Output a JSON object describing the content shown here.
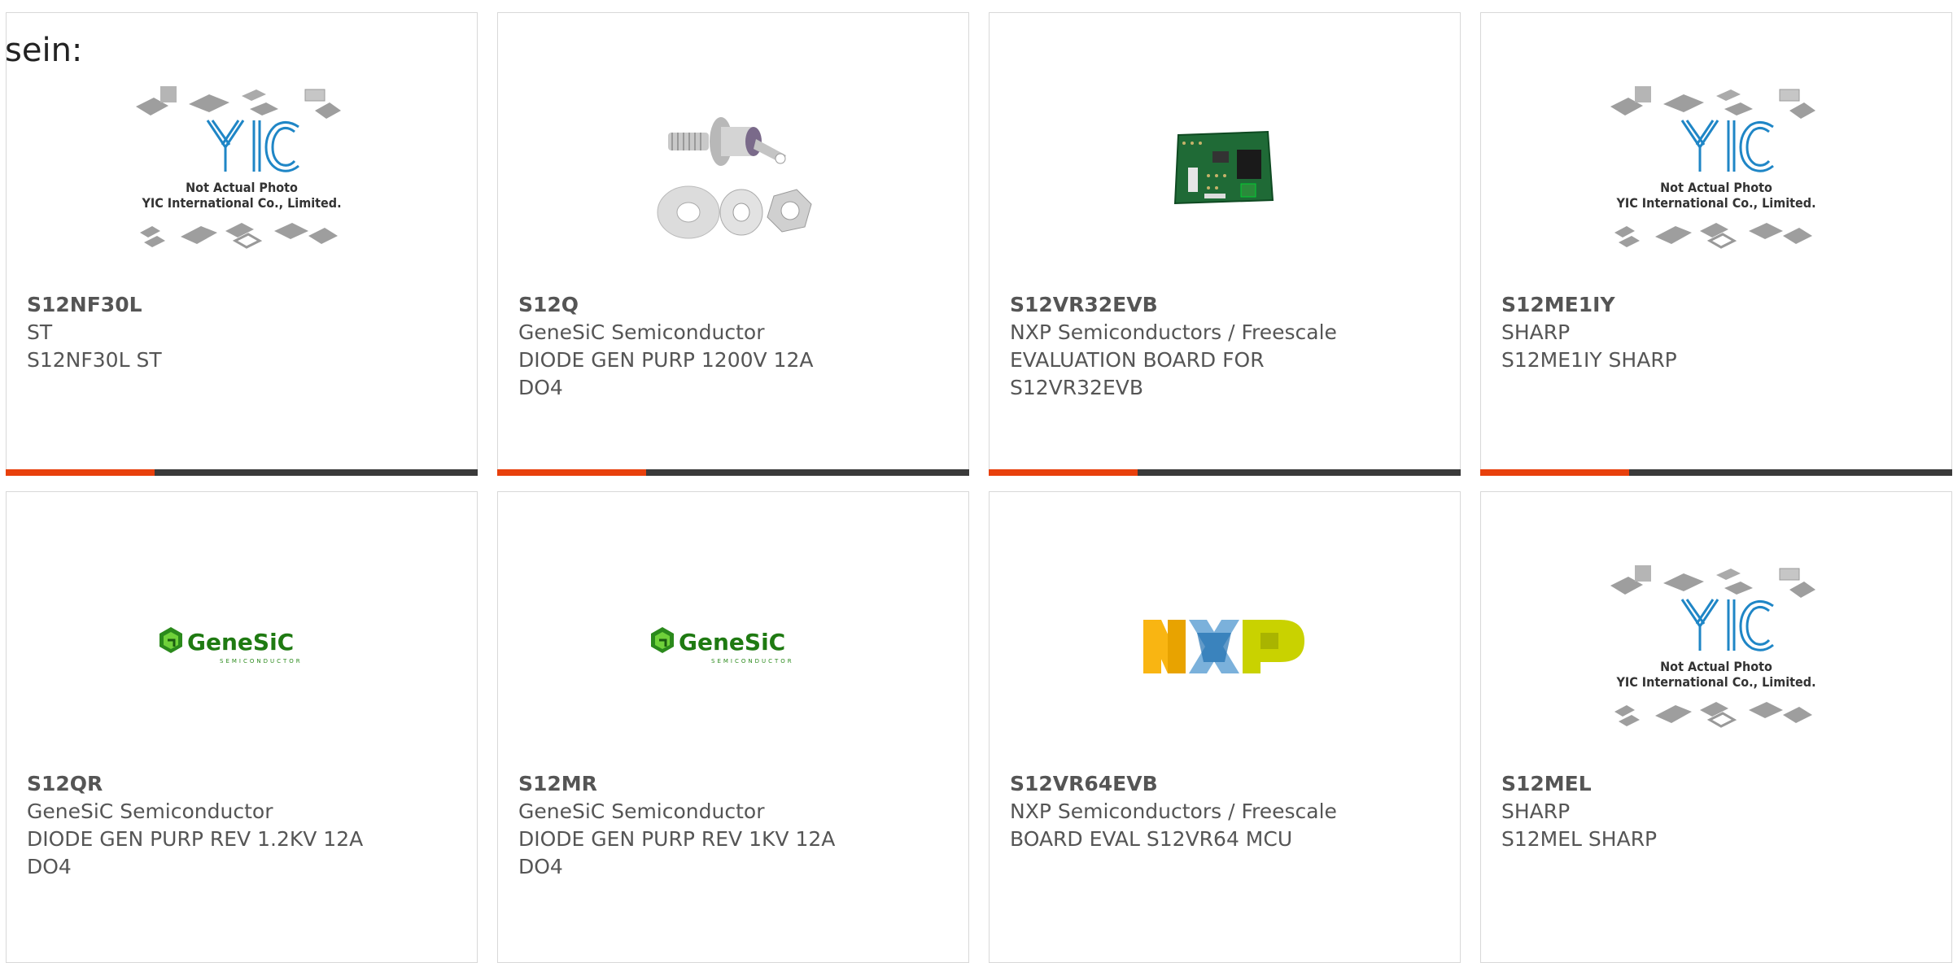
{
  "page": {
    "heading": "sein:"
  },
  "placeholder_image": {
    "line1": "Not Actual Photo",
    "line2": "YIC International Co., Limited."
  },
  "logos": {
    "genesic_word": "GeneSiC",
    "genesic_sub": "SEMICONDUCTOR"
  },
  "colors": {
    "accent": "#e8400c",
    "bar_dark": "#3a3a3a",
    "text": "#555555",
    "border": "#d8d8d8"
  },
  "products": [
    {
      "part": "S12NF30L",
      "manufacturer": "ST",
      "desc1": "S12NF30L ST",
      "desc2": "",
      "image": "yic-placeholder"
    },
    {
      "part": "S12Q",
      "manufacturer": "GeneSiC Semiconductor",
      "desc1": "DIODE GEN PURP 1200V 12A",
      "desc2": "DO4",
      "image": "stud-diode-photo"
    },
    {
      "part": "S12VR32EVB",
      "manufacturer": "NXP Semiconductors / Freescale",
      "desc1": "EVALUATION BOARD FOR",
      "desc2": "S12VR32EVB",
      "image": "pcb-board-photo"
    },
    {
      "part": "S12ME1IY",
      "manufacturer": "SHARP",
      "desc1": "S12ME1IY SHARP",
      "desc2": "",
      "image": "yic-placeholder"
    },
    {
      "part": "S12QR",
      "manufacturer": "GeneSiC Semiconductor",
      "desc1": "DIODE GEN PURP REV 1.2KV 12A",
      "desc2": "DO4",
      "image": "genesic-logo"
    },
    {
      "part": "S12MR",
      "manufacturer": "GeneSiC Semiconductor",
      "desc1": "DIODE GEN PURP REV 1KV 12A",
      "desc2": "DO4",
      "image": "genesic-logo"
    },
    {
      "part": "S12VR64EVB",
      "manufacturer": "NXP Semiconductors / Freescale",
      "desc1": "BOARD EVAL S12VR64 MCU",
      "desc2": "",
      "image": "nxp-logo"
    },
    {
      "part": "S12MEL",
      "manufacturer": "SHARP",
      "desc1": "S12MEL SHARP",
      "desc2": "",
      "image": "yic-placeholder"
    }
  ]
}
